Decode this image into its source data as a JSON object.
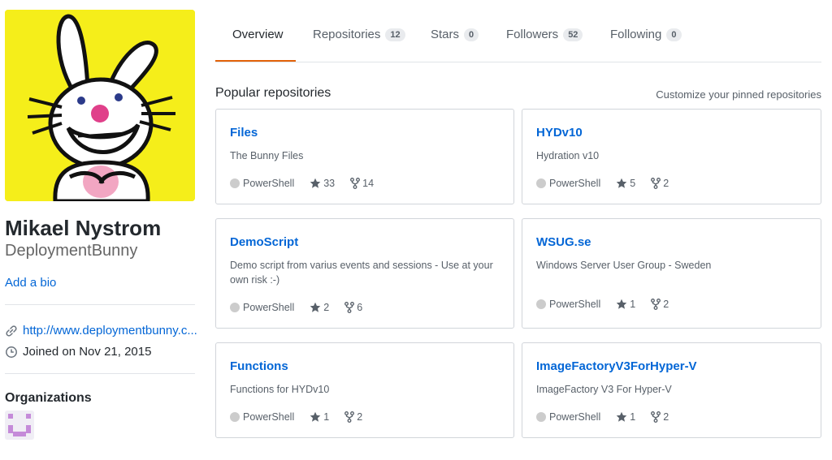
{
  "profile": {
    "fullname": "Mikael Nystrom",
    "username": "DeploymentBunny",
    "bio_link": "Add a bio",
    "website": "http://www.deploymentbunny.c...",
    "joined": "Joined on Nov 21, 2015",
    "organizations_title": "Organizations"
  },
  "tabs": [
    {
      "label": "Overview",
      "count": null,
      "active": true
    },
    {
      "label": "Repositories",
      "count": "12"
    },
    {
      "label": "Stars",
      "count": "0"
    },
    {
      "label": "Followers",
      "count": "52"
    },
    {
      "label": "Following",
      "count": "0"
    }
  ],
  "pinned": {
    "title": "Popular repositories",
    "customize_link": "Customize your pinned repositories",
    "repos": [
      {
        "name": "Files",
        "description": "The Bunny Files",
        "language": "PowerShell",
        "stars": "33",
        "forks": "14"
      },
      {
        "name": "HYDv10",
        "description": "Hydration v10",
        "language": "PowerShell",
        "stars": "5",
        "forks": "2"
      },
      {
        "name": "DemoScript",
        "description": "Demo script from varius events and sessions - Use at your own risk :-)",
        "language": "PowerShell",
        "stars": "2",
        "forks": "6"
      },
      {
        "name": "WSUG.se",
        "description": "Windows Server User Group - Sweden",
        "language": "PowerShell",
        "stars": "1",
        "forks": "2"
      },
      {
        "name": "Functions",
        "description": "Functions for HYDv10",
        "language": "PowerShell",
        "stars": "1",
        "forks": "2"
      },
      {
        "name": "ImageFactoryV3ForHyper-V",
        "description": "ImageFactory V3 For Hyper-V",
        "language": "PowerShell",
        "stars": "1",
        "forks": "2"
      }
    ]
  },
  "colors": {
    "accent_tab": "#e36209",
    "link": "#0366d6",
    "avatar_bg": "#f5ee1a",
    "language_dot": "#cccccc"
  },
  "icons": [
    "link-icon",
    "clock-icon",
    "star-icon",
    "fork-icon"
  ]
}
